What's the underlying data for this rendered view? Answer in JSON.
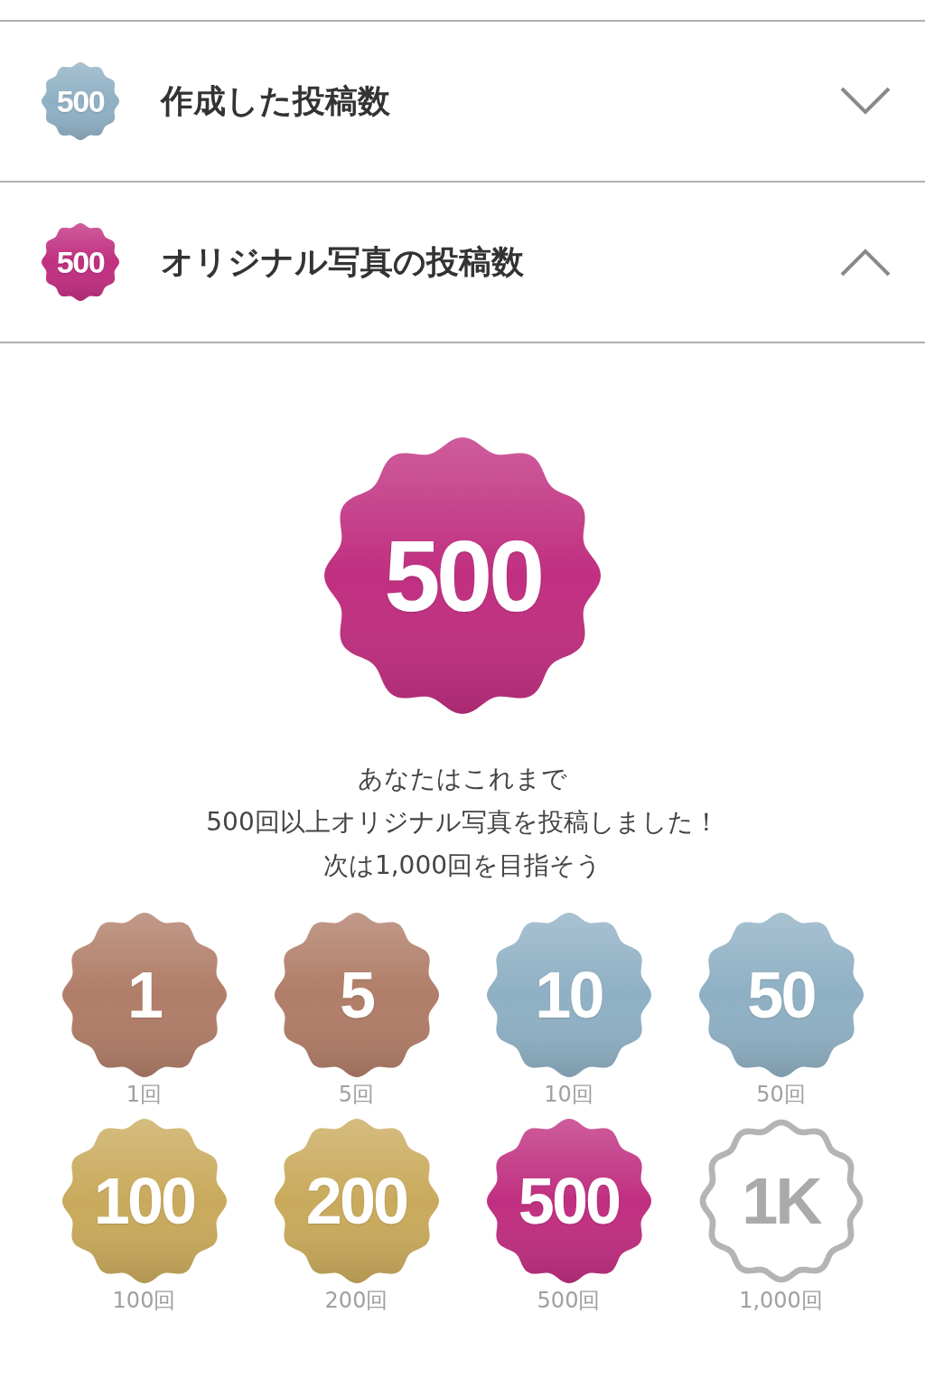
{
  "sections": [
    {
      "title": "作成した投稿数",
      "expanded": false,
      "badge": {
        "text": "500",
        "color": "#8fb0c4",
        "kind": "earned"
      }
    },
    {
      "title": "オリジナル写真の投稿数",
      "expanded": true,
      "badge": {
        "text": "500",
        "color": "#c02f80",
        "kind": "earned"
      },
      "detail": {
        "badge": {
          "text": "500",
          "color": "#c02f80",
          "kind": "earned"
        },
        "message": [
          "あなたはこれまで",
          "500回以上オリジナル写真を投稿しました！",
          "次は1,000回を目指そう"
        ],
        "milestones": [
          {
            "badge": "1",
            "label": "1回",
            "color": "#b07d68",
            "kind": "earned"
          },
          {
            "badge": "5",
            "label": "5回",
            "color": "#b07d68",
            "kind": "earned"
          },
          {
            "badge": "10",
            "label": "10回",
            "color": "#8fb0c4",
            "kind": "earned"
          },
          {
            "badge": "50",
            "label": "50回",
            "color": "#8fb0c4",
            "kind": "earned"
          },
          {
            "badge": "100",
            "label": "100回",
            "color": "#c9aa5c",
            "kind": "earned"
          },
          {
            "badge": "200",
            "label": "200回",
            "color": "#c9aa5c",
            "kind": "earned"
          },
          {
            "badge": "500",
            "label": "500回",
            "color": "#c02f80",
            "kind": "earned"
          },
          {
            "badge": "1K",
            "label": "1,000回",
            "color": "#b4b4b4",
            "kind": "locked"
          }
        ]
      }
    }
  ]
}
